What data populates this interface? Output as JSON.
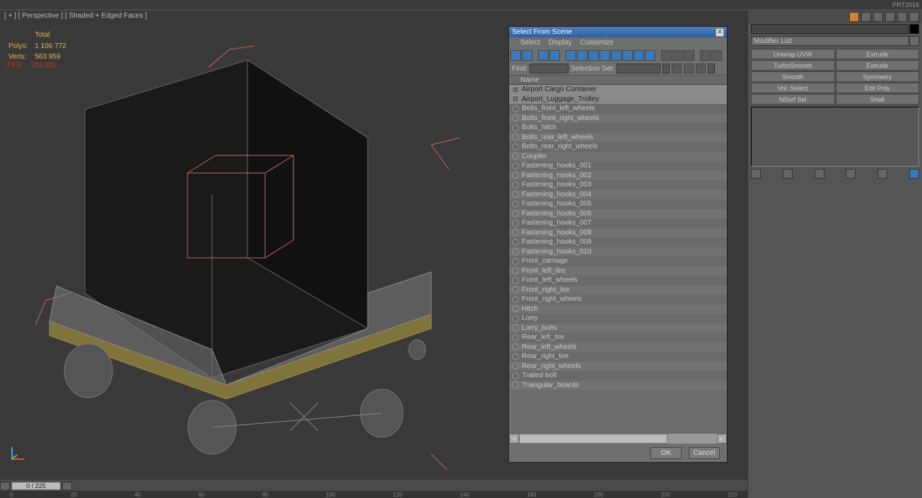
{
  "app_label": "PRT2016",
  "viewport": {
    "header": "[ + ] [ Perspective ] [ Shaded + Edged Faces ]",
    "stats": {
      "total_label": "Total",
      "polys_label": "Polys:",
      "polys_value": "1 106 772",
      "verts_label": "Verts:",
      "verts_value": "563 959",
      "fps_label": "FPS:",
      "fps_value": "234,981"
    },
    "time_slot": "0 / 225"
  },
  "dialog": {
    "title": "Select From Scene",
    "menu": {
      "select": "Select",
      "display": "Display",
      "customize": "Customize"
    },
    "find_label": "Find:",
    "selset_label": "Selection Set:",
    "name_header": "Name",
    "items": [
      {
        "label": "Airport Cargo Container",
        "icon": "group",
        "selected": true
      },
      {
        "label": "Airport_Luggage_Trolley",
        "icon": "group",
        "selected": true
      },
      {
        "label": "Bolts_front_left_wheels",
        "icon": "geom"
      },
      {
        "label": "Bolts_front_right_wheels",
        "icon": "geom"
      },
      {
        "label": "Bolts_hitch",
        "icon": "geom"
      },
      {
        "label": "Bolts_rear_left_wheels",
        "icon": "geom"
      },
      {
        "label": "Bolts_rear_right_wheels",
        "icon": "geom"
      },
      {
        "label": "Coupler",
        "icon": "geom"
      },
      {
        "label": "Fastening_hooks_001",
        "icon": "geom"
      },
      {
        "label": "Fastening_hooks_002",
        "icon": "geom"
      },
      {
        "label": "Fastening_hooks_003",
        "icon": "geom"
      },
      {
        "label": "Fastening_hooks_004",
        "icon": "geom"
      },
      {
        "label": "Fastening_hooks_005",
        "icon": "geom"
      },
      {
        "label": "Fastening_hooks_006",
        "icon": "geom"
      },
      {
        "label": "Fastening_hooks_007",
        "icon": "geom"
      },
      {
        "label": "Fastening_hooks_008",
        "icon": "geom"
      },
      {
        "label": "Fastening_hooks_009",
        "icon": "geom"
      },
      {
        "label": "Fastening_hooks_010",
        "icon": "geom"
      },
      {
        "label": "Front_carriage",
        "icon": "geom"
      },
      {
        "label": "Front_left_tire",
        "icon": "geom"
      },
      {
        "label": "Front_left_wheels",
        "icon": "geom"
      },
      {
        "label": "Front_right_tire",
        "icon": "geom"
      },
      {
        "label": "Front_right_wheels",
        "icon": "geom"
      },
      {
        "label": "Hitch",
        "icon": "geom"
      },
      {
        "label": "Lorry",
        "icon": "geom"
      },
      {
        "label": "Lorry_bolts",
        "icon": "geom"
      },
      {
        "label": "Rear_left_tire",
        "icon": "geom"
      },
      {
        "label": "Rear_left_wheels",
        "icon": "geom"
      },
      {
        "label": "Rear_right_tire",
        "icon": "geom"
      },
      {
        "label": "Rear_right_wheels",
        "icon": "geom"
      },
      {
        "label": "Trailed bolt",
        "icon": "geom"
      },
      {
        "label": "Triangular_boards",
        "icon": "geom"
      }
    ],
    "ok": "OK",
    "cancel": "Cancel"
  },
  "panel": {
    "modifier_list": "Modifier List",
    "buttons": [
      [
        "Unwrap UVW",
        "Extrude"
      ],
      [
        "TurboSmooth",
        "Extrude"
      ],
      [
        "Smooth",
        "Symmetry"
      ],
      [
        "Vol. Select",
        "Edit Poly"
      ],
      [
        "NSurf Sel",
        "Shell"
      ]
    ]
  },
  "ruler_ticks": [
    "0",
    "20",
    "40",
    "60",
    "80",
    "100",
    "120",
    "140",
    "160",
    "180",
    "200",
    "220"
  ]
}
